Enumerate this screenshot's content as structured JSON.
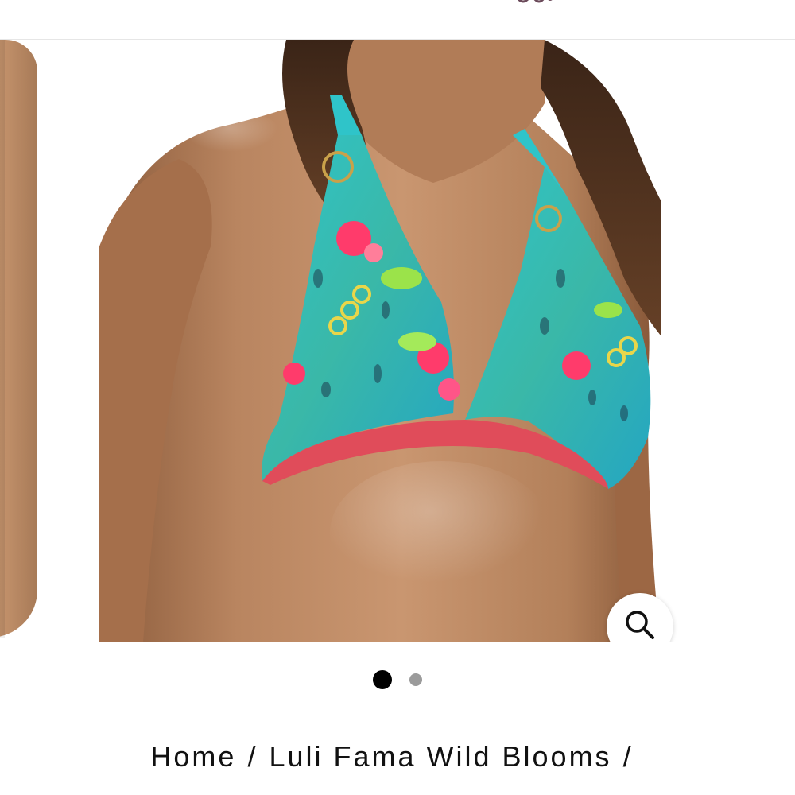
{
  "gallery": {
    "slide_count": 2,
    "active_slide": 1,
    "main_image_alt": "Luli Fama Wild Blooms halter bikini top",
    "zoom_icon": "search-icon"
  },
  "breadcrumb": {
    "items": [
      {
        "label": "Home"
      },
      {
        "label": "Luli Fama Wild Blooms"
      }
    ],
    "separator": "/"
  },
  "colors": {
    "dot_active": "#000000",
    "dot_inactive": "#9b9b9b",
    "text": "#111111"
  }
}
